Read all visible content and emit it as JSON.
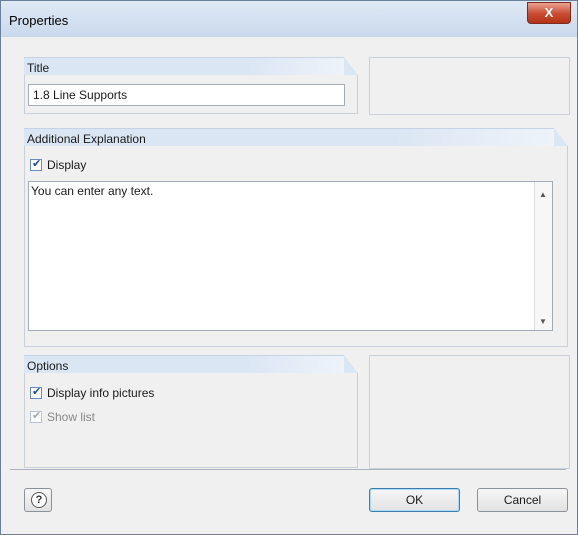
{
  "window": {
    "title": "Properties",
    "close_label": "X"
  },
  "title_section": {
    "header": "Title",
    "value": "1.8 Line Supports"
  },
  "explanation_section": {
    "header": "Additional Explanation",
    "display_checkbox": {
      "label": "Display",
      "checked": true
    },
    "text": "You can enter any text."
  },
  "options_section": {
    "header": "Options",
    "display_info_pictures": {
      "label": "Display info pictures",
      "checked": true
    },
    "show_list": {
      "label": "Show list",
      "checked": true,
      "enabled": false
    }
  },
  "buttons": {
    "ok": "OK",
    "cancel": "Cancel"
  },
  "icons": {
    "help": "help-icon",
    "close": "close-icon",
    "scroll_up": "scroll-up-arrow",
    "scroll_down": "scroll-down-arrow"
  }
}
